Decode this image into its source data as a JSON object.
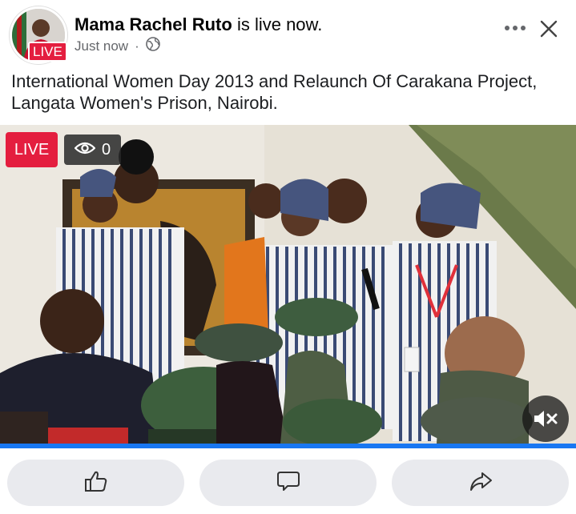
{
  "post": {
    "author": "Mama Rachel Ruto",
    "status_suffix": "is live now.",
    "timestamp": "Just now",
    "separator": "·",
    "avatar_badge": "LIVE",
    "audience_icon": "globe-icon",
    "text": "International Women Day 2013 and Relaunch Of Carakana Project, Langata Women's Prison, Nairobi."
  },
  "video": {
    "live_label": "LIVE",
    "viewer_count": "0",
    "viewer_icon": "eye-icon",
    "mute_icon": "speaker-muted-icon",
    "progress_percent": 100
  },
  "actions": [
    {
      "icon": "thumbs-up-icon",
      "name": "like"
    },
    {
      "icon": "comment-icon",
      "name": "comment"
    },
    {
      "icon": "share-icon",
      "name": "share"
    }
  ],
  "colors": {
    "live_red": "#e41e3f",
    "facebook_blue": "#1877f2",
    "button_gray": "#e9eaee",
    "meta_gray": "#65676b"
  }
}
